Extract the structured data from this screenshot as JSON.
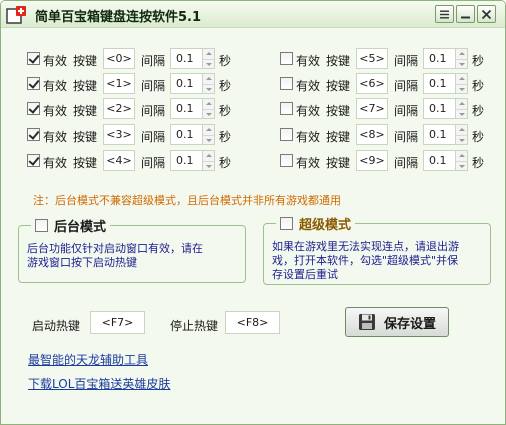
{
  "window": {
    "title": "简单百宝箱键盘连按软件5.1",
    "controls": {
      "help": "help-icon",
      "minimize": "minimize-icon",
      "close": "close-icon"
    }
  },
  "labels": {
    "enable": "有效",
    "key": "按键",
    "interval": "间隔",
    "second": "秒"
  },
  "key_rows_left": [
    {
      "enabled": true,
      "key": "<0>",
      "interval": "0.1"
    },
    {
      "enabled": true,
      "key": "<1>",
      "interval": "0.1"
    },
    {
      "enabled": true,
      "key": "<2>",
      "interval": "0.1"
    },
    {
      "enabled": true,
      "key": "<3>",
      "interval": "0.1"
    },
    {
      "enabled": true,
      "key": "<4>",
      "interval": "0.1"
    }
  ],
  "key_rows_right": [
    {
      "enabled": false,
      "key": "<5>",
      "interval": "0.1"
    },
    {
      "enabled": false,
      "key": "<6>",
      "interval": "0.1"
    },
    {
      "enabled": false,
      "key": "<7>",
      "interval": "0.1"
    },
    {
      "enabled": false,
      "key": "<8>",
      "interval": "0.1"
    },
    {
      "enabled": false,
      "key": "<9>",
      "interval": "0.1"
    }
  ],
  "note": "注：后台模式不兼容超级模式，且后台模式并非所有游戏都通用",
  "background_mode": {
    "label": "后台模式",
    "enabled": false,
    "desc_line1": "后台功能仅针对启动窗口有效，请在",
    "desc_line2": "游戏窗口按下启动热键"
  },
  "super_mode": {
    "label": "超级模式",
    "enabled": false,
    "desc_line1": "如果在游戏里无法实现连点，请退出游",
    "desc_line2": "戏，打开本软件，勾选\"超级模式\"并保",
    "desc_line3": "存设置后重试"
  },
  "hotkeys": {
    "start_label": "启动热键",
    "start_value": "<F7>",
    "stop_label": "停止热键",
    "stop_value": "<F8>"
  },
  "save_button": {
    "label": "保存设置",
    "icon": "save-icon"
  },
  "links": {
    "link1": "最智能的天龙辅助工具",
    "link2": "下载LOL百宝箱送英雄皮肤"
  },
  "colors": {
    "window_bg": "#f3f9ee",
    "border": "#8fb27a",
    "note": "#d06a00",
    "desc_text": "#1d1d8f",
    "link": "#1a3c9e",
    "super_label": "#8a5a00"
  }
}
